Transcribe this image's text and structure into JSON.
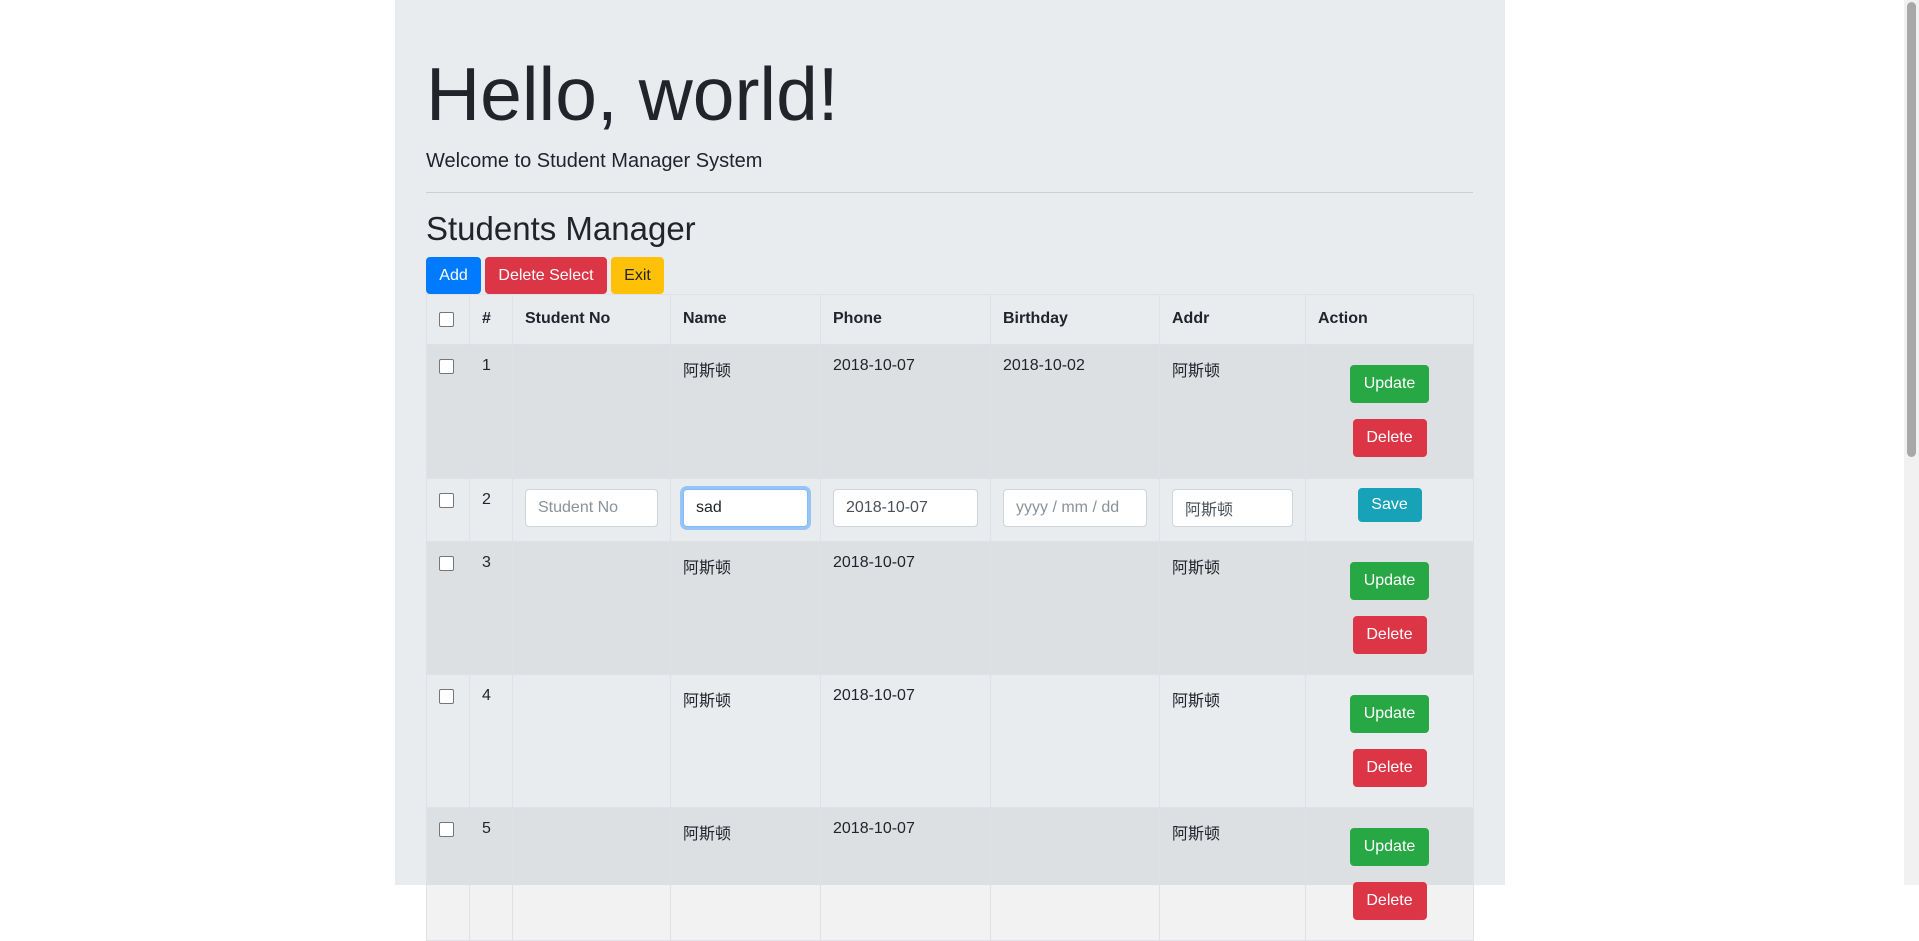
{
  "hero": {
    "title": "Hello, world!",
    "lead": "Welcome to Student Manager System"
  },
  "section": {
    "title": "Students Manager"
  },
  "toolbar": {
    "add_label": "Add",
    "delete_select_label": "Delete Select",
    "exit_label": "Exit"
  },
  "table": {
    "headers": [
      "#",
      "Student No",
      "Name",
      "Phone",
      "Birthday",
      "Addr",
      "Action"
    ],
    "rows": [
      {
        "num": "1",
        "student_no": "",
        "name": "阿斯顿",
        "phone": "2018-10-07",
        "birthday": "2018-10-02",
        "addr": "阿斯顿"
      },
      {
        "num": "2",
        "student_no": "",
        "name": "sad",
        "phone": "2018-10-07",
        "birthday": "",
        "addr": "阿斯顿"
      },
      {
        "num": "3",
        "student_no": "",
        "name": "阿斯顿",
        "phone": "2018-10-07",
        "birthday": "",
        "addr": "阿斯顿"
      },
      {
        "num": "4",
        "student_no": "",
        "name": "阿斯顿",
        "phone": "2018-10-07",
        "birthday": "",
        "addr": "阿斯顿"
      },
      {
        "num": "5",
        "student_no": "",
        "name": "阿斯顿",
        "phone": "2018-10-07",
        "birthday": "",
        "addr": "阿斯顿"
      }
    ],
    "edit_row": {
      "student_no_placeholder": "Student No",
      "birthday_placeholder": "yyyy / mm / dd"
    },
    "actions": {
      "update_label": "Update",
      "delete_label": "Delete",
      "save_label": "Save"
    }
  },
  "colors": {
    "primary": "#007bff",
    "danger": "#dc3545",
    "warning": "#ffc107",
    "success": "#28a745",
    "info": "#17a2b8",
    "jumbotron_bg": "#e9ecef"
  }
}
